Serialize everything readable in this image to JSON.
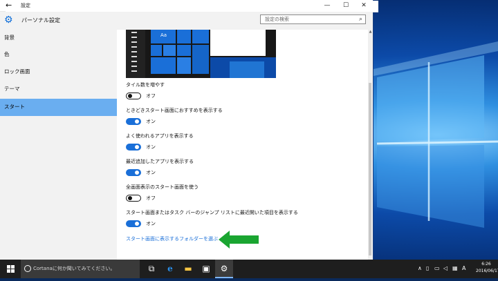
{
  "window": {
    "title": "設定",
    "back": "←",
    "minimize": "—",
    "maximize": "☐",
    "close": "✕"
  },
  "header": {
    "title": "パーソナル設定",
    "search_placeholder": "設定の検索"
  },
  "sidebar": {
    "items": [
      {
        "label": "背景"
      },
      {
        "label": "色"
      },
      {
        "label": "ロック画面"
      },
      {
        "label": "テーマ"
      },
      {
        "label": "スタート",
        "selected": true
      }
    ]
  },
  "preview": {
    "tile_label": "Aa"
  },
  "settings": [
    {
      "label": "タイル数を増やす",
      "state": "オフ",
      "on": false
    },
    {
      "label": "ときどきスタート画面におすすめを表示する",
      "state": "オン",
      "on": true
    },
    {
      "label": "よく使われるアプリを表示する",
      "state": "オン",
      "on": true
    },
    {
      "label": "最近追加したアプリを表示する",
      "state": "オン",
      "on": true
    },
    {
      "label": "全画面表示のスタート画面を使う",
      "state": "オフ",
      "on": false
    },
    {
      "label": "スタート画面またはタスク バーのジャンプ リストに最近開いた項目を表示する",
      "state": "オン",
      "on": true
    }
  ],
  "link": {
    "label": "スタート画面に表示するフォルダーを選ぶ"
  },
  "taskbar": {
    "search_text": "Cortanaに何か聞いてみてください。",
    "clock_time": "6:26",
    "clock_date": "2016/06/17"
  },
  "colors": {
    "accent": "#1a6fd8",
    "sidebar_selected": "#6aaef0",
    "arrow": "#1aa531"
  }
}
